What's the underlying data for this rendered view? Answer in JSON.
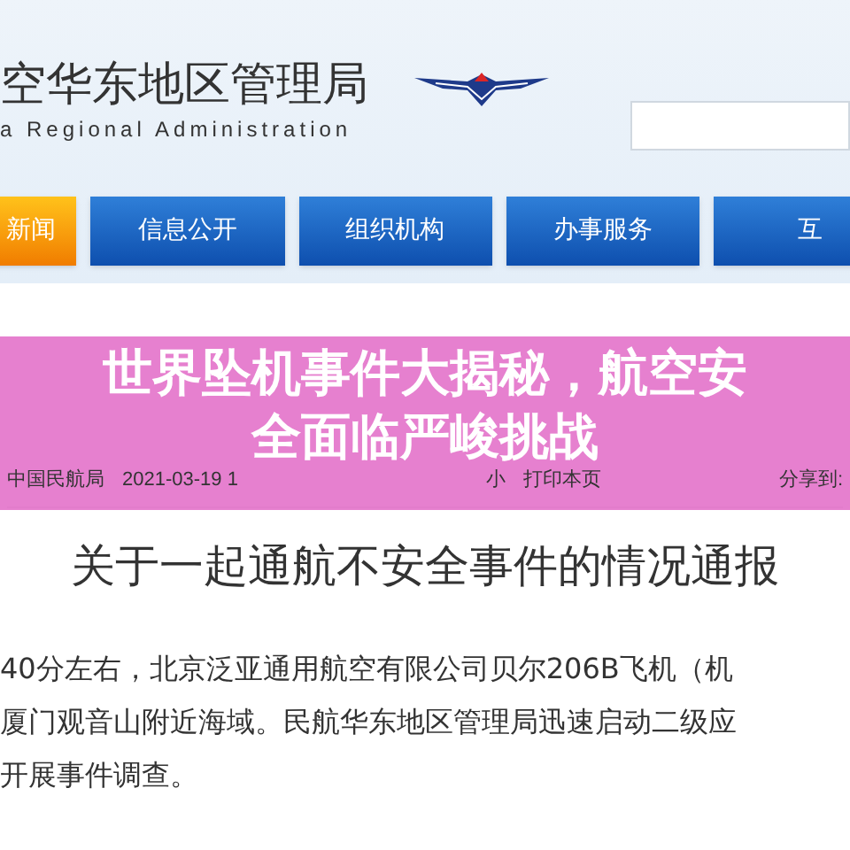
{
  "header": {
    "title": "空华东地区管理局",
    "subtitle": "a Regional Administration"
  },
  "nav": [
    {
      "label": "新闻",
      "selected": true
    },
    {
      "label": "信息公开",
      "selected": false
    },
    {
      "label": "组织机构",
      "selected": false
    },
    {
      "label": "办事服务",
      "selected": false
    },
    {
      "label": "互",
      "selected": false
    }
  ],
  "article": {
    "meta": {
      "source": "中国民航局",
      "date": "2021-03-19 1",
      "font_size": "小",
      "print": "打印本页",
      "share": "分享到:"
    },
    "title": "关于一起通航不安全事件的情况通报",
    "lines": [
      "40分左右，北京泛亚通用航空有限公司贝尔206B飞机（机",
      "厦门观音山附近海域。民航华东地区管理局迅速启动二级应",
      "开展事件调查。"
    ]
  },
  "banner": {
    "headline_lines": [
      "世界坠机事件大揭秘，航空安",
      "全面临严峻挑战"
    ]
  }
}
